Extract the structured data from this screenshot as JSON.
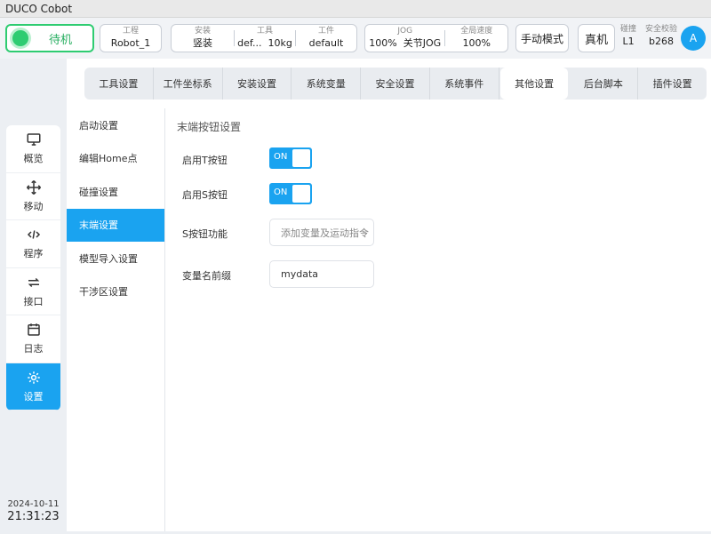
{
  "window": {
    "title": "DUCO Cobot"
  },
  "header": {
    "status": "待机",
    "project": {
      "label": "工程",
      "value": "Robot_1"
    },
    "install": {
      "label": "安装",
      "value": "竖装"
    },
    "tool": {
      "label": "工具",
      "name": "def...",
      "weight": "10kg"
    },
    "workpiece": {
      "label": "工件",
      "value": "default"
    },
    "jog": {
      "label": "JOG",
      "percent": "100%",
      "mode": "关节JOG"
    },
    "global_speed": {
      "label": "全局速度",
      "value": "100%"
    },
    "manual_mode": "手动模式",
    "real_machine": "真机",
    "collision": {
      "label": "碰撞",
      "value": "L1"
    },
    "safety_check": {
      "label": "安全校验",
      "value": "b268"
    },
    "avatar": "A",
    "status_color": "#2ecc71"
  },
  "nav": {
    "items": [
      {
        "label": "概览",
        "icon": "monitor-icon"
      },
      {
        "label": "移动",
        "icon": "move-arrows-icon"
      },
      {
        "label": "程序",
        "icon": "code-icon"
      },
      {
        "label": "接口",
        "icon": "swap-icon"
      },
      {
        "label": "日志",
        "icon": "calendar-icon"
      },
      {
        "label": "设置",
        "icon": "gear-icon"
      }
    ],
    "active": "设置",
    "accent": "#1aa3f0"
  },
  "clock": {
    "date": "2024-10-11",
    "time": "21:31:23"
  },
  "tabs": {
    "items": [
      "工具设置",
      "工件坐标系",
      "安装设置",
      "系统变量",
      "安全设置",
      "系统事件",
      "其他设置",
      "后台脚本",
      "插件设置"
    ],
    "active": "其他设置"
  },
  "submenu": {
    "items": [
      "启动设置",
      "编辑Home点",
      "碰撞设置",
      "末端设置",
      "模型导入设置",
      "干涉区设置"
    ],
    "active": "末端设置"
  },
  "content": {
    "title": "末端按钮设置",
    "enable_t": {
      "label": "启用T按钮",
      "state": "ON"
    },
    "enable_s": {
      "label": "启用S按钮",
      "state": "ON"
    },
    "s_function": {
      "label": "S按钮功能",
      "value": "添加变量及运动指令"
    },
    "var_prefix": {
      "label": "变量名前缀",
      "value": "mydata"
    }
  }
}
